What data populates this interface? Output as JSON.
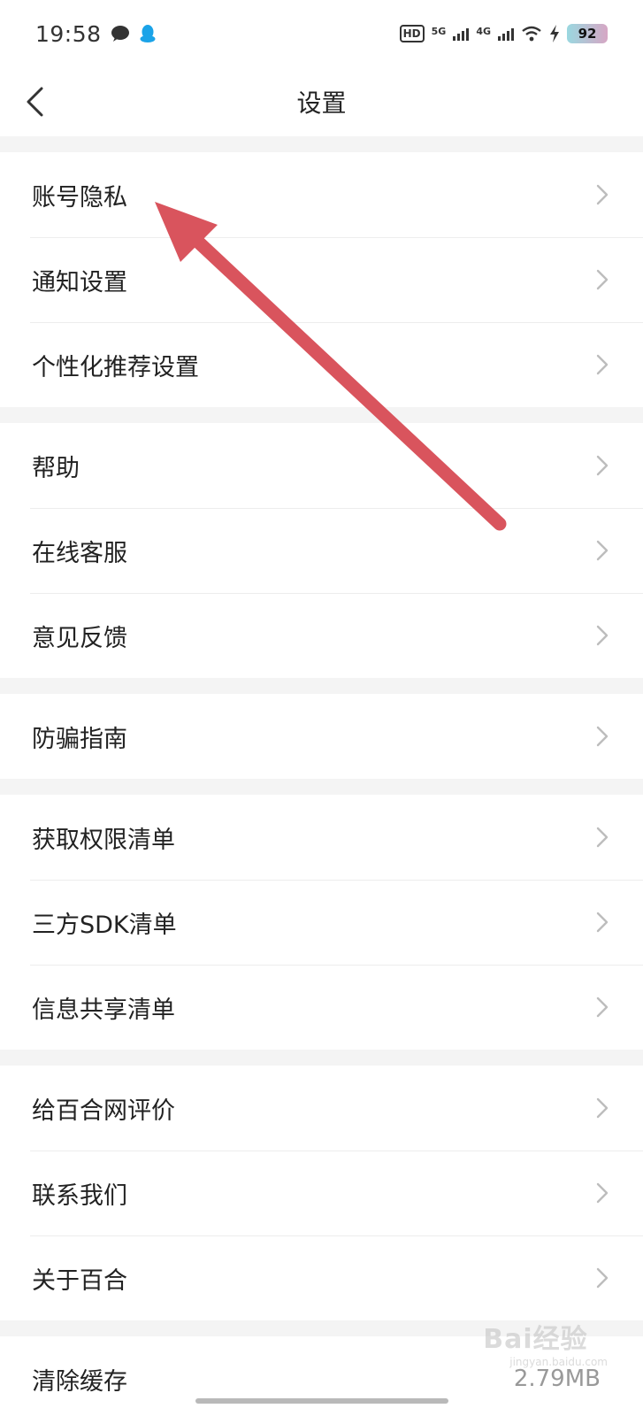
{
  "status_bar": {
    "time": "19:58",
    "icons": [
      "chat-bubble-icon",
      "qq-penguin-icon"
    ],
    "hd": "HD",
    "net1": "5G",
    "net2": "4G",
    "battery": "92"
  },
  "nav": {
    "title": "设置",
    "back_icon": "chevron-left-icon"
  },
  "groups": [
    {
      "items": [
        {
          "label": "账号隐私"
        },
        {
          "label": "通知设置"
        },
        {
          "label": "个性化推荐设置"
        }
      ]
    },
    {
      "items": [
        {
          "label": "帮助"
        },
        {
          "label": "在线客服"
        },
        {
          "label": "意见反馈"
        }
      ]
    },
    {
      "items": [
        {
          "label": "防骗指南"
        }
      ]
    },
    {
      "items": [
        {
          "label": "获取权限清单"
        },
        {
          "label": "三方SDK清单"
        },
        {
          "label": "信息共享清单"
        }
      ]
    },
    {
      "items": [
        {
          "label": "给百合网评价"
        },
        {
          "label": "联系我们"
        },
        {
          "label": "关于百合"
        }
      ]
    },
    {
      "items": [
        {
          "label": "清除缓存",
          "value": "2.79MB"
        }
      ]
    }
  ],
  "annotation": {
    "color": "#d9545d"
  },
  "watermark": {
    "text": "Bai经验",
    "sub": "jingyan.baidu.com"
  }
}
